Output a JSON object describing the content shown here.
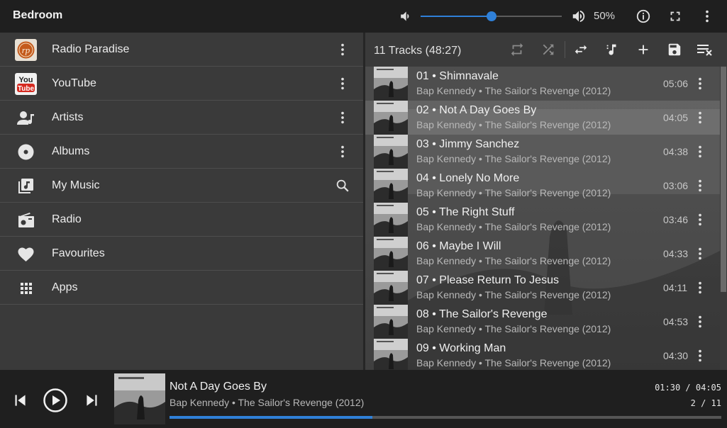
{
  "header": {
    "player_name": "Bedroom",
    "volume_label": "50%",
    "volume_fraction": 0.5,
    "accent_color": "#2f80d8"
  },
  "browse": {
    "items": [
      {
        "label": "Radio Paradise",
        "icon": "radio-paradise-logo",
        "action": "more-vert-icon"
      },
      {
        "label": "YouTube",
        "icon": "youtube-logo",
        "action": "more-vert-icon"
      },
      {
        "label": "Artists",
        "icon": "artist-icon",
        "action": "more-vert-icon"
      },
      {
        "label": "Albums",
        "icon": "album-icon",
        "action": "more-vert-icon"
      },
      {
        "label": "My Music",
        "icon": "library-music-icon",
        "action": "search-icon"
      },
      {
        "label": "Radio",
        "icon": "radio-icon",
        "action": ""
      },
      {
        "label": "Favourites",
        "icon": "heart-icon",
        "action": ""
      },
      {
        "label": "Apps",
        "icon": "apps-grid-icon",
        "action": ""
      }
    ],
    "logo_text": {
      "rp": "rp",
      "you": "You",
      "tube": "Tube"
    }
  },
  "queue": {
    "count_label": "11 Tracks (48:27)",
    "toolbar_icons": [
      "repeat-icon",
      "shuffle-icon",
      "swap-icon",
      "add-track-icon",
      "add-icon",
      "save-icon",
      "clear-queue-icon"
    ],
    "tracks": [
      {
        "title": "01 • Shimnavale",
        "sub": "Bap Kennedy • The Sailor's Revenge (2012)",
        "duration": "05:06"
      },
      {
        "title": "02 • Not A Day Goes By",
        "sub": "Bap Kennedy • The Sailor's Revenge (2012)",
        "duration": "04:05",
        "current": true
      },
      {
        "title": "03 • Jimmy Sanchez",
        "sub": "Bap Kennedy • The Sailor's Revenge (2012)",
        "duration": "04:38"
      },
      {
        "title": "04 • Lonely No More",
        "sub": "Bap Kennedy • The Sailor's Revenge (2012)",
        "duration": "03:06"
      },
      {
        "title": "05 • The Right Stuff",
        "sub": "Bap Kennedy • The Sailor's Revenge (2012)",
        "duration": "03:46"
      },
      {
        "title": "06 • Maybe I Will",
        "sub": "Bap Kennedy • The Sailor's Revenge (2012)",
        "duration": "04:33"
      },
      {
        "title": "07 • Please Return To Jesus",
        "sub": "Bap Kennedy • The Sailor's Revenge (2012)",
        "duration": "04:11"
      },
      {
        "title": "08 • The Sailor's Revenge",
        "sub": "Bap Kennedy • The Sailor's Revenge (2012)",
        "duration": "04:53"
      },
      {
        "title": "09 • Working Man",
        "sub": "Bap Kennedy • The Sailor's Revenge (2012)",
        "duration": "04:30"
      }
    ]
  },
  "now_playing": {
    "title": "Not A Day Goes By",
    "sub": "Bap Kennedy • The Sailor's Revenge (2012)",
    "time": "01:30 / 04:05",
    "position": "2 / 11",
    "progress_fraction": 0.367
  }
}
